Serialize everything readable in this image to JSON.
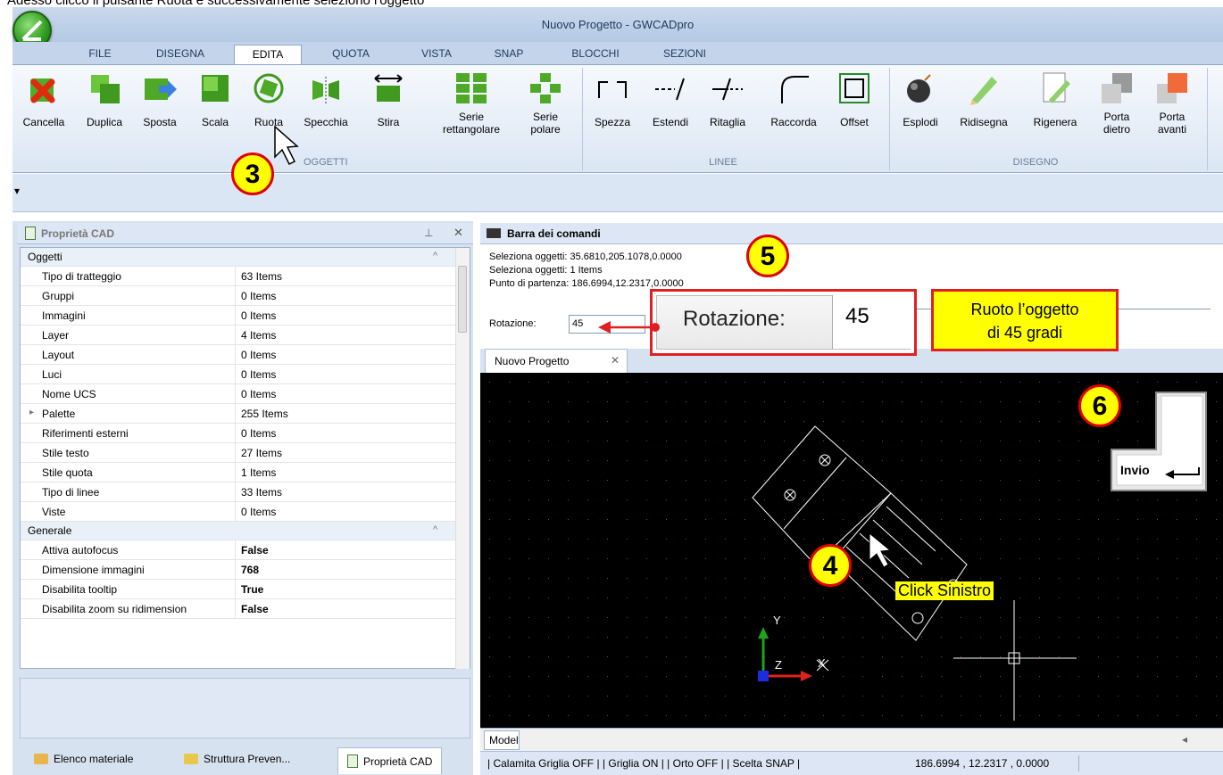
{
  "top_caption": "Adesso clicco il pulsante Ruota e successivamente seleziono l'oggetto",
  "window": {
    "title": "Nuovo Progetto - GWCADpro"
  },
  "menu_tabs": [
    "FILE",
    "DISEGNA",
    "EDITA",
    "QUOTA",
    "VISTA",
    "SNAP",
    "BLOCCHI",
    "SEZIONI"
  ],
  "active_tab": "EDITA",
  "ribbon": {
    "buttons": [
      "Cancella",
      "Duplica",
      "Sposta",
      "Scala",
      "Ruota",
      "Specchia",
      "Stira",
      "Serie rettangolare",
      "Serie polare",
      "Spezza",
      "Estendi",
      "Ritaglia",
      "Raccorda",
      "Offset",
      "Esplodi",
      "Ridisegna",
      "Rigenera",
      "Porta dietro",
      "Porta avanti"
    ],
    "groups": [
      "OGGETTI",
      "LINEE",
      "DISEGNO"
    ]
  },
  "properties": {
    "title": "Proprietà CAD",
    "categories": [
      {
        "name": "Oggetti",
        "rows": [
          {
            "k": "Tipo di tratteggio",
            "v": "63 Items"
          },
          {
            "k": "Gruppi",
            "v": "0 Items"
          },
          {
            "k": "Immagini",
            "v": "0 Items"
          },
          {
            "k": "Layer",
            "v": "4 Items"
          },
          {
            "k": "Layout",
            "v": "0 Items"
          },
          {
            "k": "Luci",
            "v": "0 Items"
          },
          {
            "k": "Nome UCS",
            "v": "0 Items"
          },
          {
            "k": "Palette",
            "v": "255 Items"
          },
          {
            "k": "Riferimenti esterni",
            "v": "0 Items"
          },
          {
            "k": "Stile testo",
            "v": "27 Items"
          },
          {
            "k": "Stile quota",
            "v": "1 Items"
          },
          {
            "k": "Tipo di linee",
            "v": "33 Items"
          },
          {
            "k": "Viste",
            "v": "0 Items"
          }
        ]
      },
      {
        "name": "Generale",
        "rows": [
          {
            "k": "Attiva autofocus",
            "v": "False"
          },
          {
            "k": "Dimensione immagini",
            "v": "768"
          },
          {
            "k": "Disabilita tooltip",
            "v": "True"
          },
          {
            "k": "Disabilita zoom su ridimension",
            "v": "False"
          }
        ]
      }
    ]
  },
  "bottom_tabs": [
    "Elenco materiale",
    "Struttura Preven...",
    "Proprietà CAD"
  ],
  "command_bar": {
    "title": "Barra dei comandi",
    "lines": [
      "Seleziona oggetti: 35.6810,205.1078,0.0000",
      "Seleziona oggetti: 1 Items",
      "Punto di partenza: 186.6994,12.2317,0.0000"
    ],
    "prompt_label": "Rotazione:",
    "prompt_value": "45"
  },
  "document_tab": "Nuovo Progetto",
  "model_tab": "Model",
  "status": {
    "text": "| Calamita Griglia OFF | | Griglia ON | | Orto OFF | | Scelta SNAP |",
    "coords": "186.6994 , 12.2317 , 0.0000"
  },
  "annotations": {
    "step3": "3",
    "step4": "4",
    "step5": "5",
    "step6": "6",
    "click_label": "Click Sinistro",
    "zoom_label": "Rotazione:",
    "zoom_value": "45",
    "note_line1": "Ruoto l’oggetto",
    "note_line2": "di 45 gradi",
    "enter_key": "Invio"
  },
  "axis": {
    "x": "X",
    "y": "Y",
    "z": "Z"
  }
}
